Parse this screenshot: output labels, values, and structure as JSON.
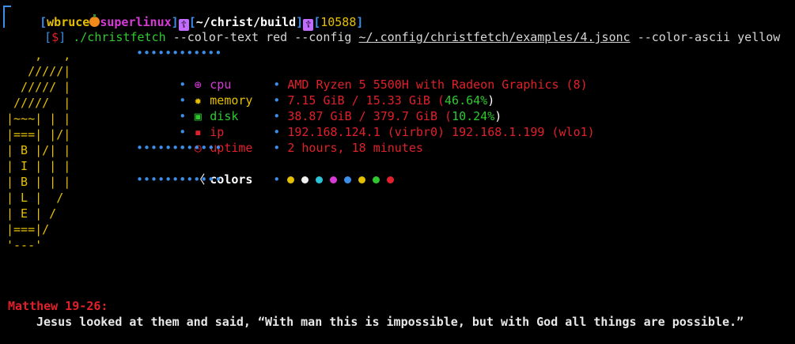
{
  "prompt": {
    "user": "wbruce",
    "host": "superlinux",
    "cwd": "~/christ/build",
    "job": "10588",
    "symbol": "$",
    "command": "./christfetch",
    "arg1": "--color-text red --config ",
    "config_path": "~/.config/christfetch/examples/4.jsonc",
    "arg2": " --color-ascii yellow"
  },
  "ascii_art": [
    "    ,   ,",
    "   /////|",
    "  ///// |",
    " /////  |",
    "|~~~| | |",
    "|===| |/|",
    "| B |/| |",
    "| I | | |",
    "| B | | |",
    "| L |  /",
    "| E | /",
    "|===|/",
    "'---'"
  ],
  "separator": "••••••••••••",
  "info": [
    {
      "icon": "globe-icon",
      "glyph": "⊕",
      "label": "cpu",
      "value": "AMD Ryzen 5 5500H with Radeon Graphics (8)",
      "color": "#d83ad8"
    },
    {
      "icon": "chip-icon",
      "glyph": "✹",
      "label": "memory",
      "value": "7.15 GiB / 15.33 GiB (",
      "pct": "46.64%",
      "tail": ")",
      "color": "#e5c000"
    },
    {
      "icon": "disk-icon",
      "glyph": "▣",
      "label": "disk",
      "value": "38.87 GiB / 379.7 GiB (",
      "pct": "10.24%",
      "tail": ")",
      "color": "#2fc92f"
    },
    {
      "icon": "network-icon",
      "glyph": "▪",
      "label": "ip",
      "value": "192.168.124.1 (virbr0) 192.168.1.199 (wlo1)",
      "color": "#e0202a"
    },
    {
      "icon": "clock-icon",
      "glyph": "◷",
      "label": "uptime",
      "value": "2 hours, 18 minutes",
      "color": "#e0202a"
    }
  ],
  "colors_label": "colors",
  "colors_glyph": "〈",
  "swatches": [
    "#e5c000",
    "#f0f0f0",
    "#29c4d8",
    "#d83ad8",
    "#3b8eea",
    "#e5c000",
    "#2fc92f",
    "#e0202a"
  ],
  "verse": {
    "reference": "Matthew 19-26:",
    "text": "Jesus looked at them and said, “With man this is impossible, but with God all things are possible.”"
  }
}
